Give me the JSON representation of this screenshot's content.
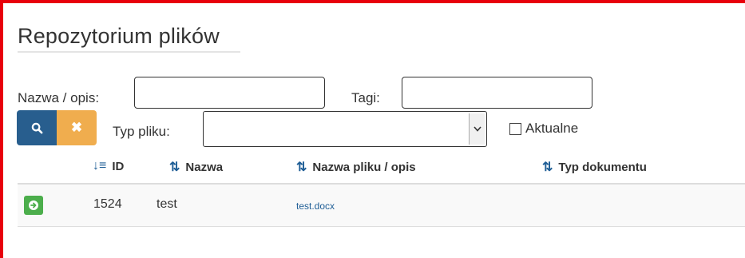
{
  "page": {
    "title": "Repozytorium plików"
  },
  "filters": {
    "name_label": "Nazwa / opis:",
    "name_value": "",
    "tags_label": "Tagi:",
    "tags_value": "",
    "filetype_label": "Typ pliku:",
    "filetype_value": "",
    "current_label": "Aktualne",
    "current_checked": false
  },
  "buttons": {
    "search_icon": "search-icon",
    "clear_icon": "close-icon",
    "clear_glyph": "✖"
  },
  "table": {
    "columns": [
      "ID",
      "Nazwa",
      "Nazwa pliku / opis",
      "Typ dokumentu"
    ],
    "rows": [
      {
        "id": "1524",
        "name": "test",
        "file": "test.docx",
        "doc_type": ""
      }
    ]
  },
  "colors": {
    "frame": "#e8000b",
    "primary": "#285e8e",
    "warning": "#f0ad4e",
    "success": "#4cae4c",
    "link": "#1f5e96"
  }
}
